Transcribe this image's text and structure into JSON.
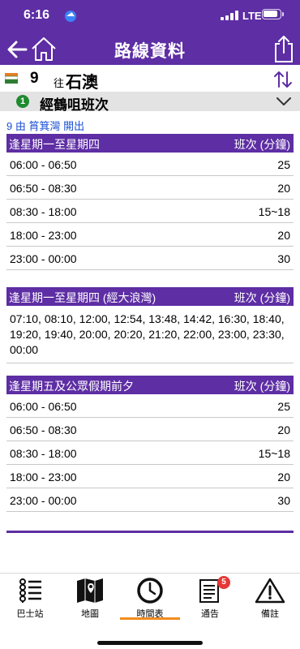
{
  "status_bar": {
    "time": "6:16",
    "network": "LTE"
  },
  "nav": {
    "title": "路線資料"
  },
  "route": {
    "number": "9",
    "dest_prefix": "往",
    "destination": "石澳"
  },
  "variant": {
    "badge": "1",
    "label": "經鶴咀班次"
  },
  "origin_line": "9 由 筲箕灣 開出",
  "timetable": [
    {
      "title": "逢星期一至星期四",
      "freq_header": "班次 (分鐘)",
      "rows": [
        {
          "period": "06:00 - 06:50",
          "freq": "25"
        },
        {
          "period": "06:50 - 08:30",
          "freq": "20"
        },
        {
          "period": "08:30 - 18:00",
          "freq": "15~18"
        },
        {
          "period": "18:00 - 23:00",
          "freq": "20"
        },
        {
          "period": "23:00 - 00:00",
          "freq": "30"
        }
      ]
    },
    {
      "title": "逢星期一至星期四 (經大浪灣)",
      "freq_header": "班次 (分鐘)",
      "departures": "07:10, 08:10, 12:00, 12:54, 13:48, 14:42, 16:30, 18:40, 19:20, 19:40, 20:00, 20:20, 21:20, 22:00, 23:00, 23:30, 00:00"
    },
    {
      "title": "逢星期五及公眾假期前夕",
      "freq_header": "班次 (分鐘)",
      "rows": [
        {
          "period": "06:00 - 06:50",
          "freq": "25"
        },
        {
          "period": "06:50 - 08:30",
          "freq": "20"
        },
        {
          "period": "08:30 - 18:00",
          "freq": "15~18"
        },
        {
          "period": "18:00 - 23:00",
          "freq": "20"
        },
        {
          "period": "23:00 - 00:00",
          "freq": "30"
        }
      ]
    }
  ],
  "tabs": [
    {
      "label": "巴士站",
      "icon": "bus-stop-list-icon"
    },
    {
      "label": "地圖",
      "icon": "map-icon"
    },
    {
      "label": "時間表",
      "icon": "clock-icon",
      "active": true
    },
    {
      "label": "通告",
      "icon": "notice-icon",
      "badge": "5"
    },
    {
      "label": "備註",
      "icon": "warning-icon"
    }
  ],
  "colors": {
    "primary": "#5e2ea4",
    "link": "#1a4fd6",
    "active_tab": "#f28c1e",
    "badge": "#e53935",
    "variant_badge": "#1f8a2e"
  }
}
